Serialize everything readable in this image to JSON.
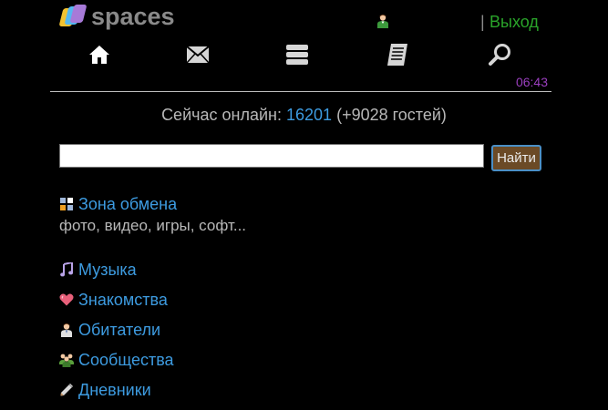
{
  "header": {
    "logo_text": "spaces",
    "separator": "|",
    "logout_label": "Выход",
    "time": "06:43"
  },
  "nav": {
    "items": [
      {
        "name": "home",
        "icon": "home-icon"
      },
      {
        "name": "mail",
        "icon": "envelope-icon"
      },
      {
        "name": "feed",
        "icon": "layers-icon"
      },
      {
        "name": "journal",
        "icon": "notepad-icon"
      },
      {
        "name": "search",
        "icon": "magnifier-icon"
      }
    ]
  },
  "online": {
    "prefix": "Сейчас онлайн:",
    "count": "16201",
    "guests": "(+9028 гостей)"
  },
  "search": {
    "value": "",
    "placeholder": "",
    "button_label": "Найти"
  },
  "menu": {
    "exchange": {
      "label": "Зона обмена",
      "subtitle": "фото, видео, игры, софт...",
      "icon": "grid-icon"
    },
    "items": [
      {
        "label": "Музыка",
        "icon": "music-note-icon"
      },
      {
        "label": "Знакомства",
        "icon": "heart-icon"
      },
      {
        "label": "Обитатели",
        "icon": "person-icon"
      },
      {
        "label": "Сообщества",
        "icon": "group-icon"
      },
      {
        "label": "Дневники",
        "icon": "pen-icon"
      }
    ]
  },
  "colors": {
    "background": "#000000",
    "link": "#3d9be0",
    "logout": "#2aa52a",
    "time": "#9b3fbf",
    "text": "#b8b8b8",
    "button_bg": "#6b4a26",
    "button_border": "#4a8fc6"
  }
}
